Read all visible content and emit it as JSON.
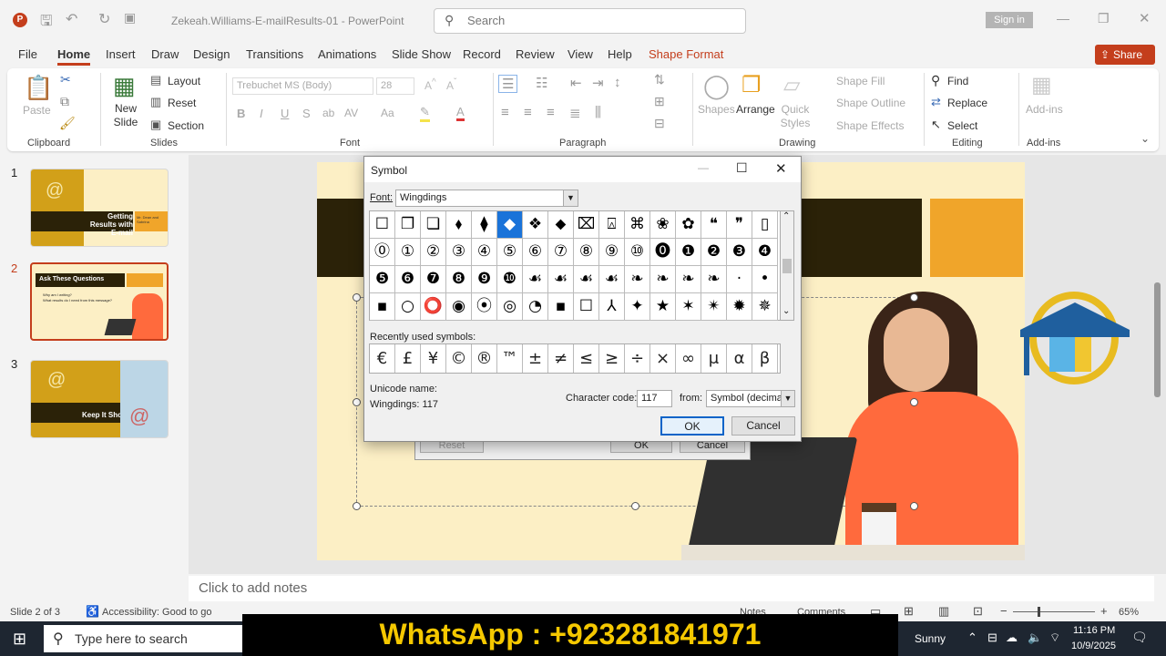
{
  "titlebar": {
    "doc_title": "Zekeah.Williams-E-mailResults-01  -  PowerPoint",
    "search_placeholder": "Search",
    "signin": "Sign in"
  },
  "tabs": [
    "File",
    "Home",
    "Insert",
    "Draw",
    "Design",
    "Transitions",
    "Animations",
    "Slide Show",
    "Record",
    "Review",
    "View",
    "Help",
    "Shape Format"
  ],
  "share": "Share",
  "ribbon": {
    "clipboard": {
      "paste": "Paste",
      "label": "Clipboard"
    },
    "slides": {
      "new_slide": "New Slide",
      "layout": "Layout",
      "reset": "Reset",
      "section": "Section",
      "label": "Slides"
    },
    "font": {
      "font_name": "Trebuchet MS (Body)",
      "font_size": "28",
      "label": "Font"
    },
    "paragraph": {
      "label": "Paragraph"
    },
    "drawing": {
      "shapes": "Shapes",
      "arrange": "Arrange",
      "quick_styles": "Quick Styles",
      "shape_fill": "Shape Fill",
      "shape_outline": "Shape Outline",
      "shape_effects": "Shape Effects",
      "label": "Drawing"
    },
    "editing": {
      "find": "Find",
      "replace": "Replace",
      "select": "Select",
      "label": "Editing"
    },
    "addins": {
      "addins": "Add-ins",
      "label": "Add-ins"
    }
  },
  "slides": [
    {
      "num": "1",
      "title": "Getting Results with E-mail",
      "byline": "Mr. Dean and Sabrina"
    },
    {
      "num": "2",
      "title": "Ask These Questions",
      "b1": "Why am I writing?",
      "b2": "What results do I need from this message?"
    },
    {
      "num": "3",
      "title": "Keep It Short"
    }
  ],
  "notes_placeholder": "Click to add notes",
  "behind_dialog": {
    "reset": "Reset",
    "ok": "OK",
    "cancel": "Cancel"
  },
  "dialog": {
    "title": "Symbol",
    "font_label": "Font:",
    "font_value": "Wingdings",
    "symbols": [
      "☐",
      "❐",
      "❏",
      "⬧",
      "⧫",
      "◆",
      "❖",
      "⬥",
      "⌧",
      "⍓",
      "⌘",
      "❀",
      "✿",
      "❝",
      "❞",
      "▯",
      "⓪",
      "①",
      "②",
      "③",
      "④",
      "⑤",
      "⑥",
      "⑦",
      "⑧",
      "⑨",
      "⑩",
      "⓿",
      "❶",
      "❷",
      "❸",
      "❹",
      "❺",
      "❻",
      "❼",
      "❽",
      "❾",
      "❿",
      "☙",
      "☙",
      "☙",
      "☙",
      "❧",
      "❧",
      "❧",
      "❧",
      "·",
      "•",
      "▪",
      "○",
      "⭕",
      "◉",
      "⦿",
      "◎",
      "◔",
      "▪",
      "☐",
      "⅄",
      "✦",
      "★",
      "✶",
      "✴",
      "✹",
      "✵"
    ],
    "selected_index": 5,
    "recent_label": "Recently used symbols:",
    "recent": [
      "€",
      "£",
      "¥",
      "©",
      "®",
      "™",
      "±",
      "≠",
      "≤",
      "≥",
      "÷",
      "×",
      "∞",
      "μ",
      "α",
      "β"
    ],
    "unicode_label": "Unicode name:",
    "unicode_value": "Wingdings: 117",
    "charcode_label": "Character code:",
    "charcode_value": "117",
    "from_label": "from:",
    "from_value": "Symbol (decimal)",
    "ok": "OK",
    "cancel": "Cancel"
  },
  "status": {
    "slide": "Slide 2 of 3",
    "accessibility": "Accessibility: Good to go",
    "notes": "Notes",
    "comments": "Comments",
    "zoom": "65%"
  },
  "taskbar": {
    "search_placeholder": "Type here to search",
    "weather": "Sunny",
    "time": "11:16 PM",
    "date": "10/9/2025"
  },
  "overlay": {
    "whatsapp": "WhatsApp : +923281841971"
  },
  "colors": {
    "accent": "#c43e1c",
    "slide_bg": "#fcefc5",
    "dark_band": "#2b2208",
    "orange_box": "#f0a52a",
    "selected": "#1a73d9"
  }
}
